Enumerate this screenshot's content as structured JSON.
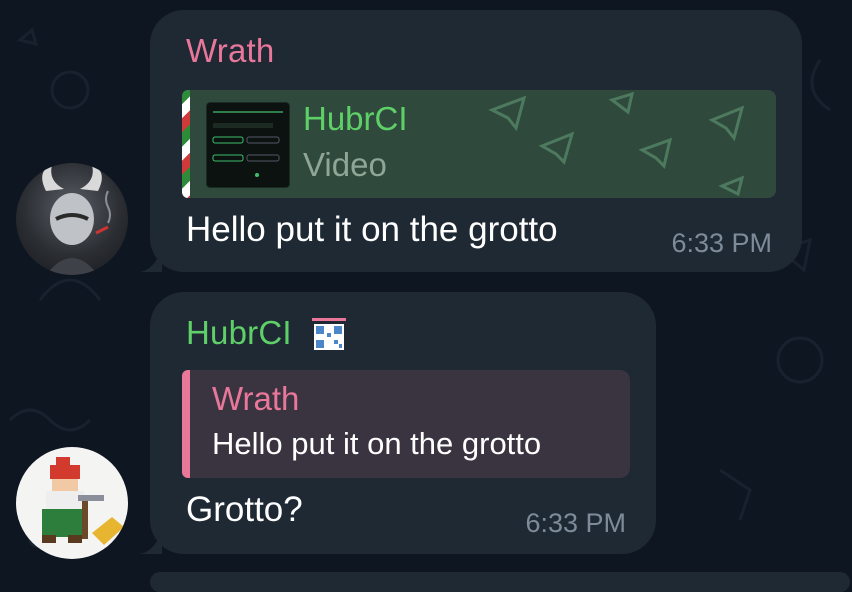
{
  "messages": [
    {
      "sender": "Wrath",
      "forwarded_preview": {
        "title": "HubrCI",
        "subtitle": "Video"
      },
      "text": "Hello put it on the grotto",
      "time": "6:33 PM"
    },
    {
      "sender": "HubrCI",
      "sender_badge_icon": "qr-code-icon",
      "reply": {
        "name": "Wrath",
        "text": "Hello put it on the grotto"
      },
      "text": "Grotto?",
      "time": "6:33 PM"
    }
  ],
  "colors": {
    "background": "#0e1621",
    "bubble": "#1f2934",
    "wrath_name": "#e8779a",
    "hubrci_name": "#5fd068",
    "reply_bg": "#3a3441",
    "preview_bg": "#2f4a3c",
    "time": "#7e8b98"
  }
}
